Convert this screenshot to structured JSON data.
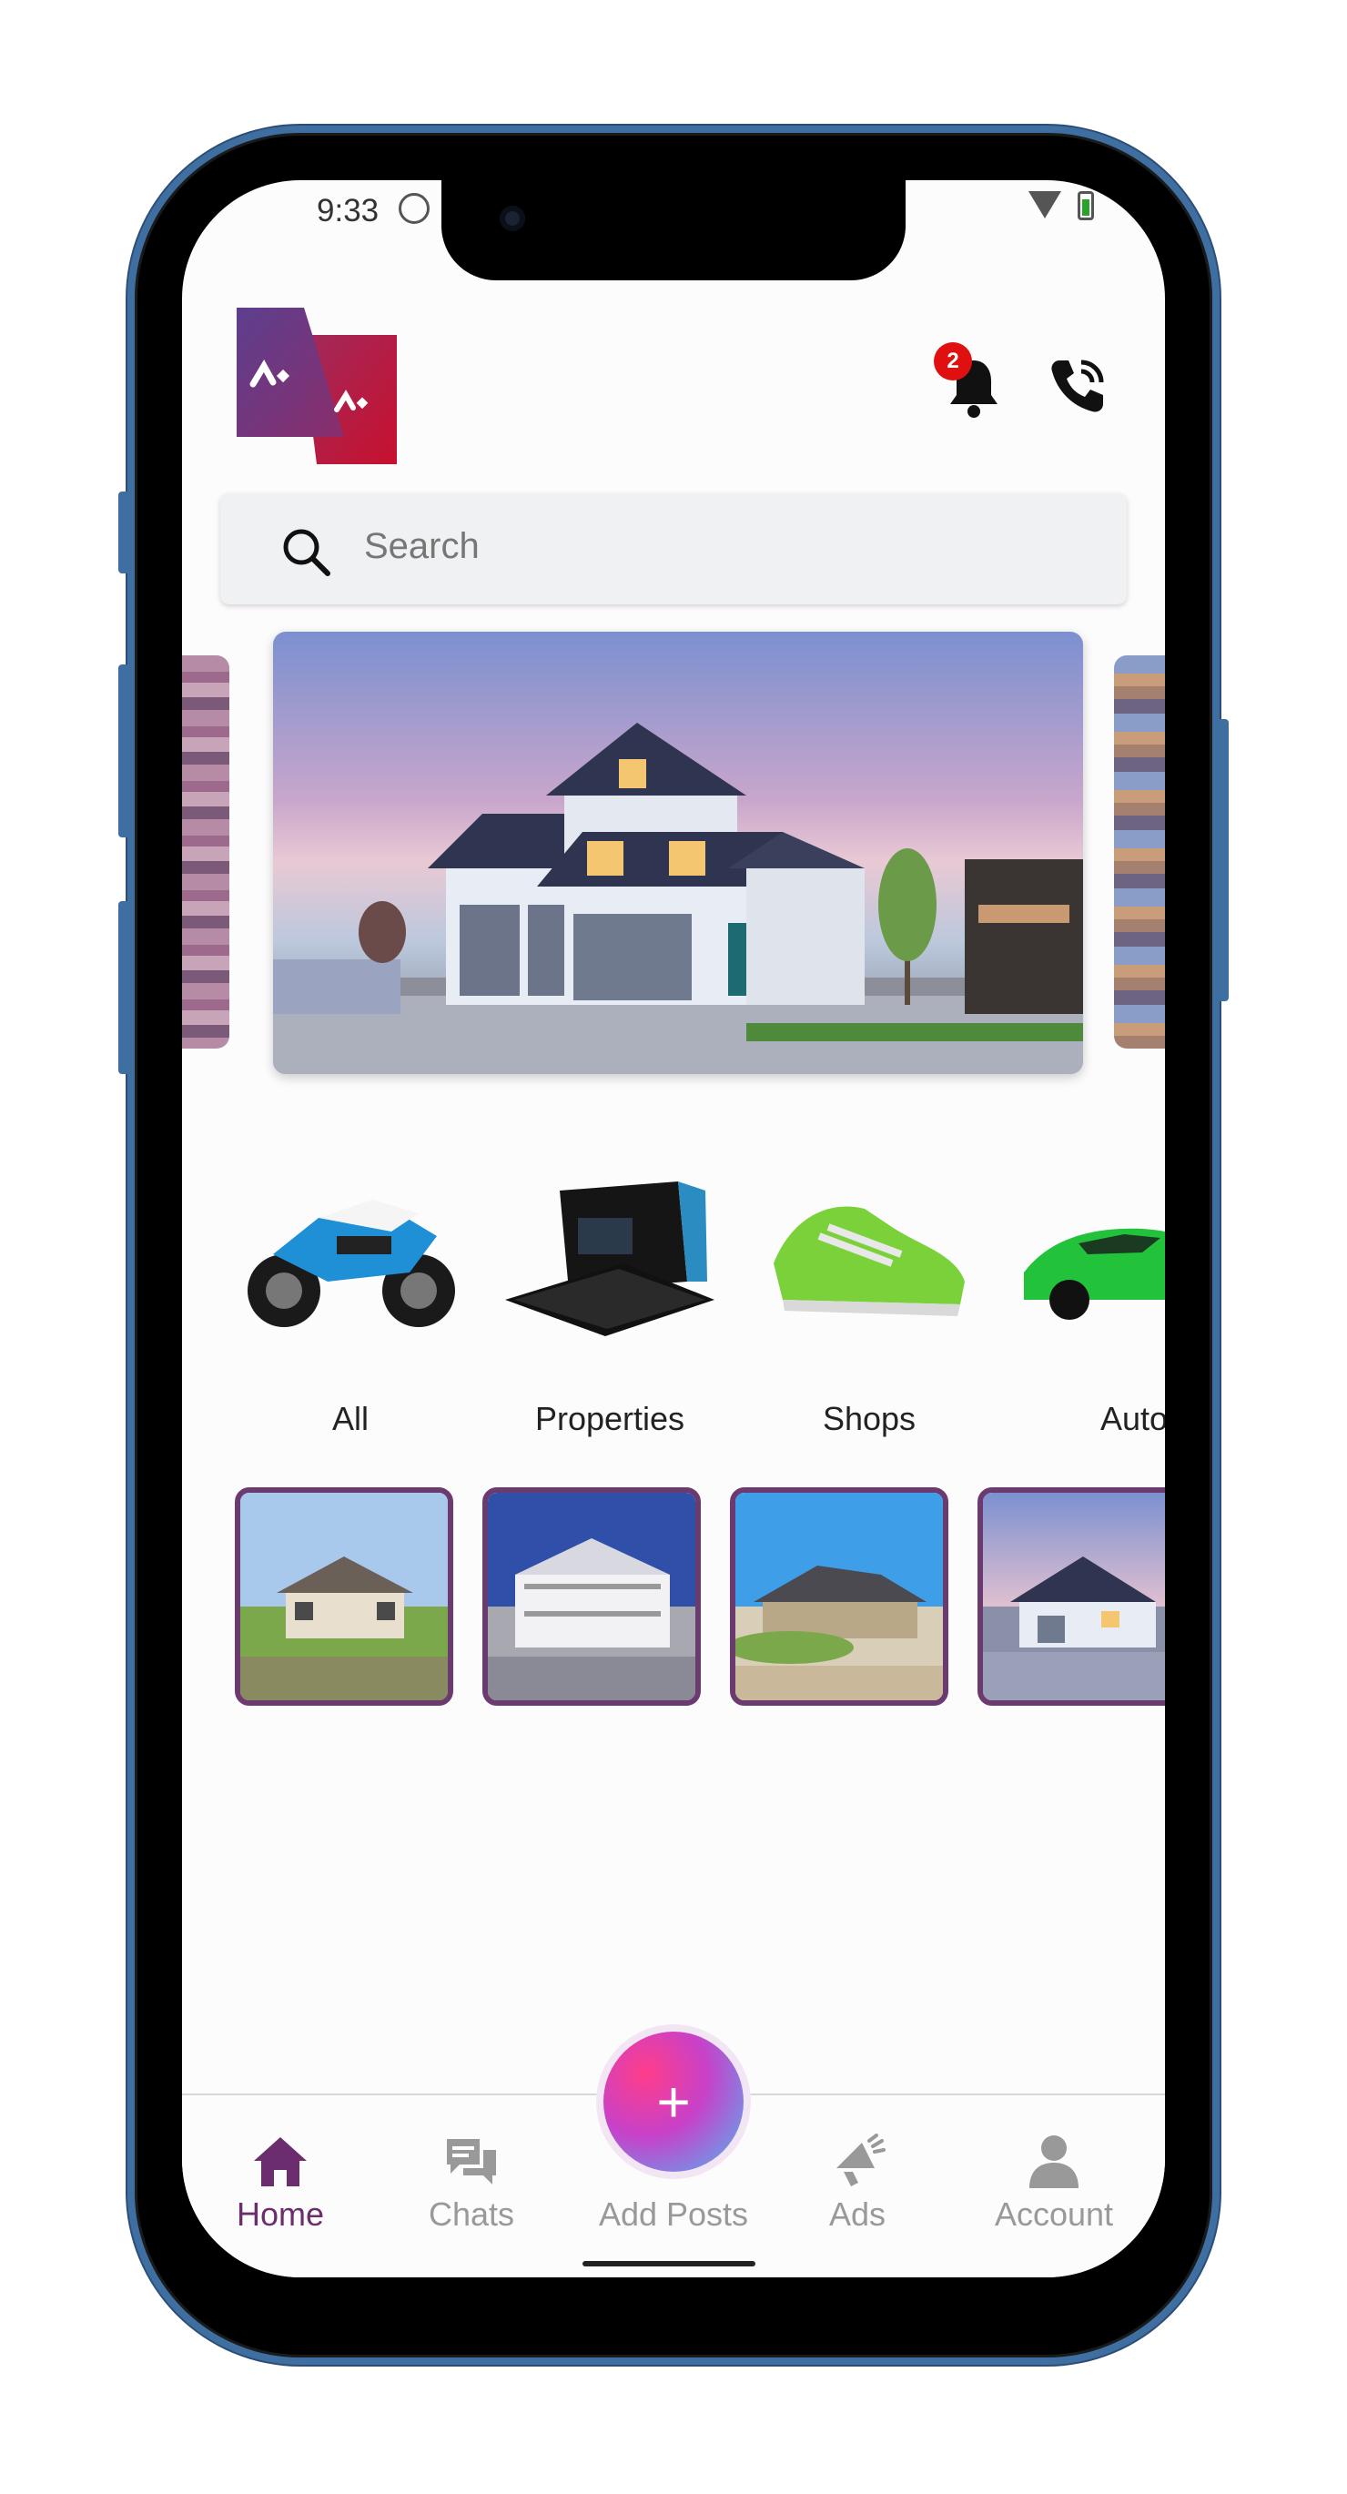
{
  "status_bar": {
    "time": "9:33"
  },
  "header": {
    "notification_count": "2",
    "colors": {
      "brand_purple": "#6b2d6e",
      "brand_red": "#c8102e",
      "badge_red": "#e01010"
    }
  },
  "search": {
    "placeholder": "Search"
  },
  "categories": [
    {
      "label": "All",
      "icon": "motorcycle"
    },
    {
      "label": "Properties",
      "icon": "keyboard-box"
    },
    {
      "label": "Shops",
      "icon": "sneaker"
    },
    {
      "label": "Auto",
      "icon": "sports-car"
    }
  ],
  "bottom_nav": {
    "home": "Home",
    "chats": "Chats",
    "add_posts": "Add Posts",
    "ads": "Ads",
    "account": "Account",
    "add_symbol": "+"
  }
}
